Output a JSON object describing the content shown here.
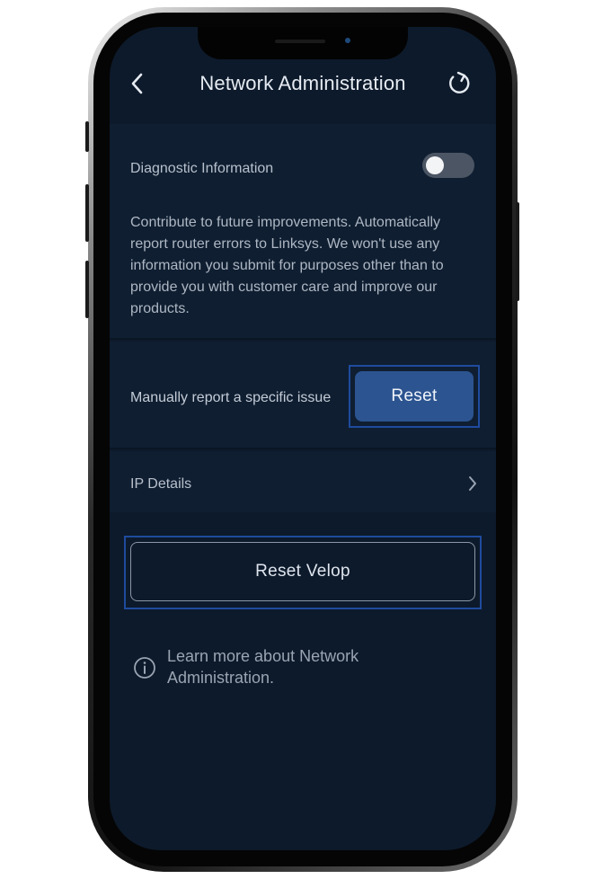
{
  "header": {
    "title": "Network Administration",
    "back_icon": "chevron-left-icon",
    "refresh_icon": "refresh-icon"
  },
  "diagnostic": {
    "label": "Diagnostic Information",
    "toggle_on": false,
    "description": "Contribute to future improvements. Automatically report router errors to Linksys. We won't use any information you submit for purposes other than to provide you with customer care and improve our products."
  },
  "manual_report": {
    "label": "Manually report a specific issue",
    "button_label": "Reset"
  },
  "ip_details": {
    "label": "IP Details"
  },
  "reset_velop": {
    "button_label": "Reset Velop"
  },
  "learn_more": {
    "text": "Learn more about Network Administration."
  },
  "colors": {
    "screen_bg": "#0d1a2b",
    "card_bg": "#0f1e31",
    "accent_button": "#2c5490",
    "highlight_border": "#1f4b9e",
    "toggle_off": "#4b5563"
  }
}
